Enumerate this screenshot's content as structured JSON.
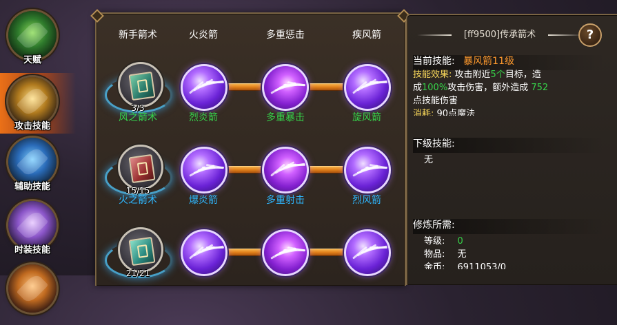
{
  "nav": {
    "items": [
      {
        "label": "天赋",
        "color": "#2e7a2c"
      },
      {
        "label": "攻击技能",
        "color": "#b07a1e"
      },
      {
        "label": "辅助技能",
        "color": "#2a6bb8"
      },
      {
        "label": "时装技能",
        "color": "#8a55c8"
      }
    ],
    "active_index": 1
  },
  "tree": {
    "rows": [
      {
        "name_color": "#ffffff",
        "base": {
          "name": "新手箭术",
          "level_count": "3/3"
        },
        "skills": [
          "火炎箭",
          "多重惩击",
          "疾风箭"
        ]
      },
      {
        "name_color": "#36d24a",
        "base": {
          "name": "风之箭术",
          "level_count": "15/15"
        },
        "skills": [
          "烈炎箭",
          "多重暴击",
          "旋风箭"
        ]
      },
      {
        "name_color": "#2fb8ff",
        "base": {
          "name": "火之箭术",
          "level_count": "21/21"
        },
        "skills": [
          "爆炎箭",
          "多重射击",
          "烈风箭"
        ]
      }
    ]
  },
  "info": {
    "title": "[ff9500]传承箭术",
    "help_label": "?",
    "current_skill": {
      "label": "当前技能:",
      "value": "暴风箭11级",
      "effect_label": "技能效果:",
      "effect_text_1": "攻击附近",
      "effect_count": "5个",
      "effect_text_2": "目标，造",
      "effect_text_3": "成",
      "effect_percent": "100%",
      "effect_text_4": "攻击伤害，额外造成",
      "effect_extra": "752",
      "effect_text_5": "点技能伤害",
      "cost_label": "消耗:",
      "cost_value": "90点魔法"
    },
    "next_skill": {
      "label": "下级技能:",
      "value": "无"
    },
    "training": {
      "label": "修炼所需:",
      "level_label": "等级:",
      "level_value": "0",
      "item_label": "物品:",
      "item_value": "无",
      "gold_label": "金币:",
      "gold_value": "6911053/0"
    }
  }
}
